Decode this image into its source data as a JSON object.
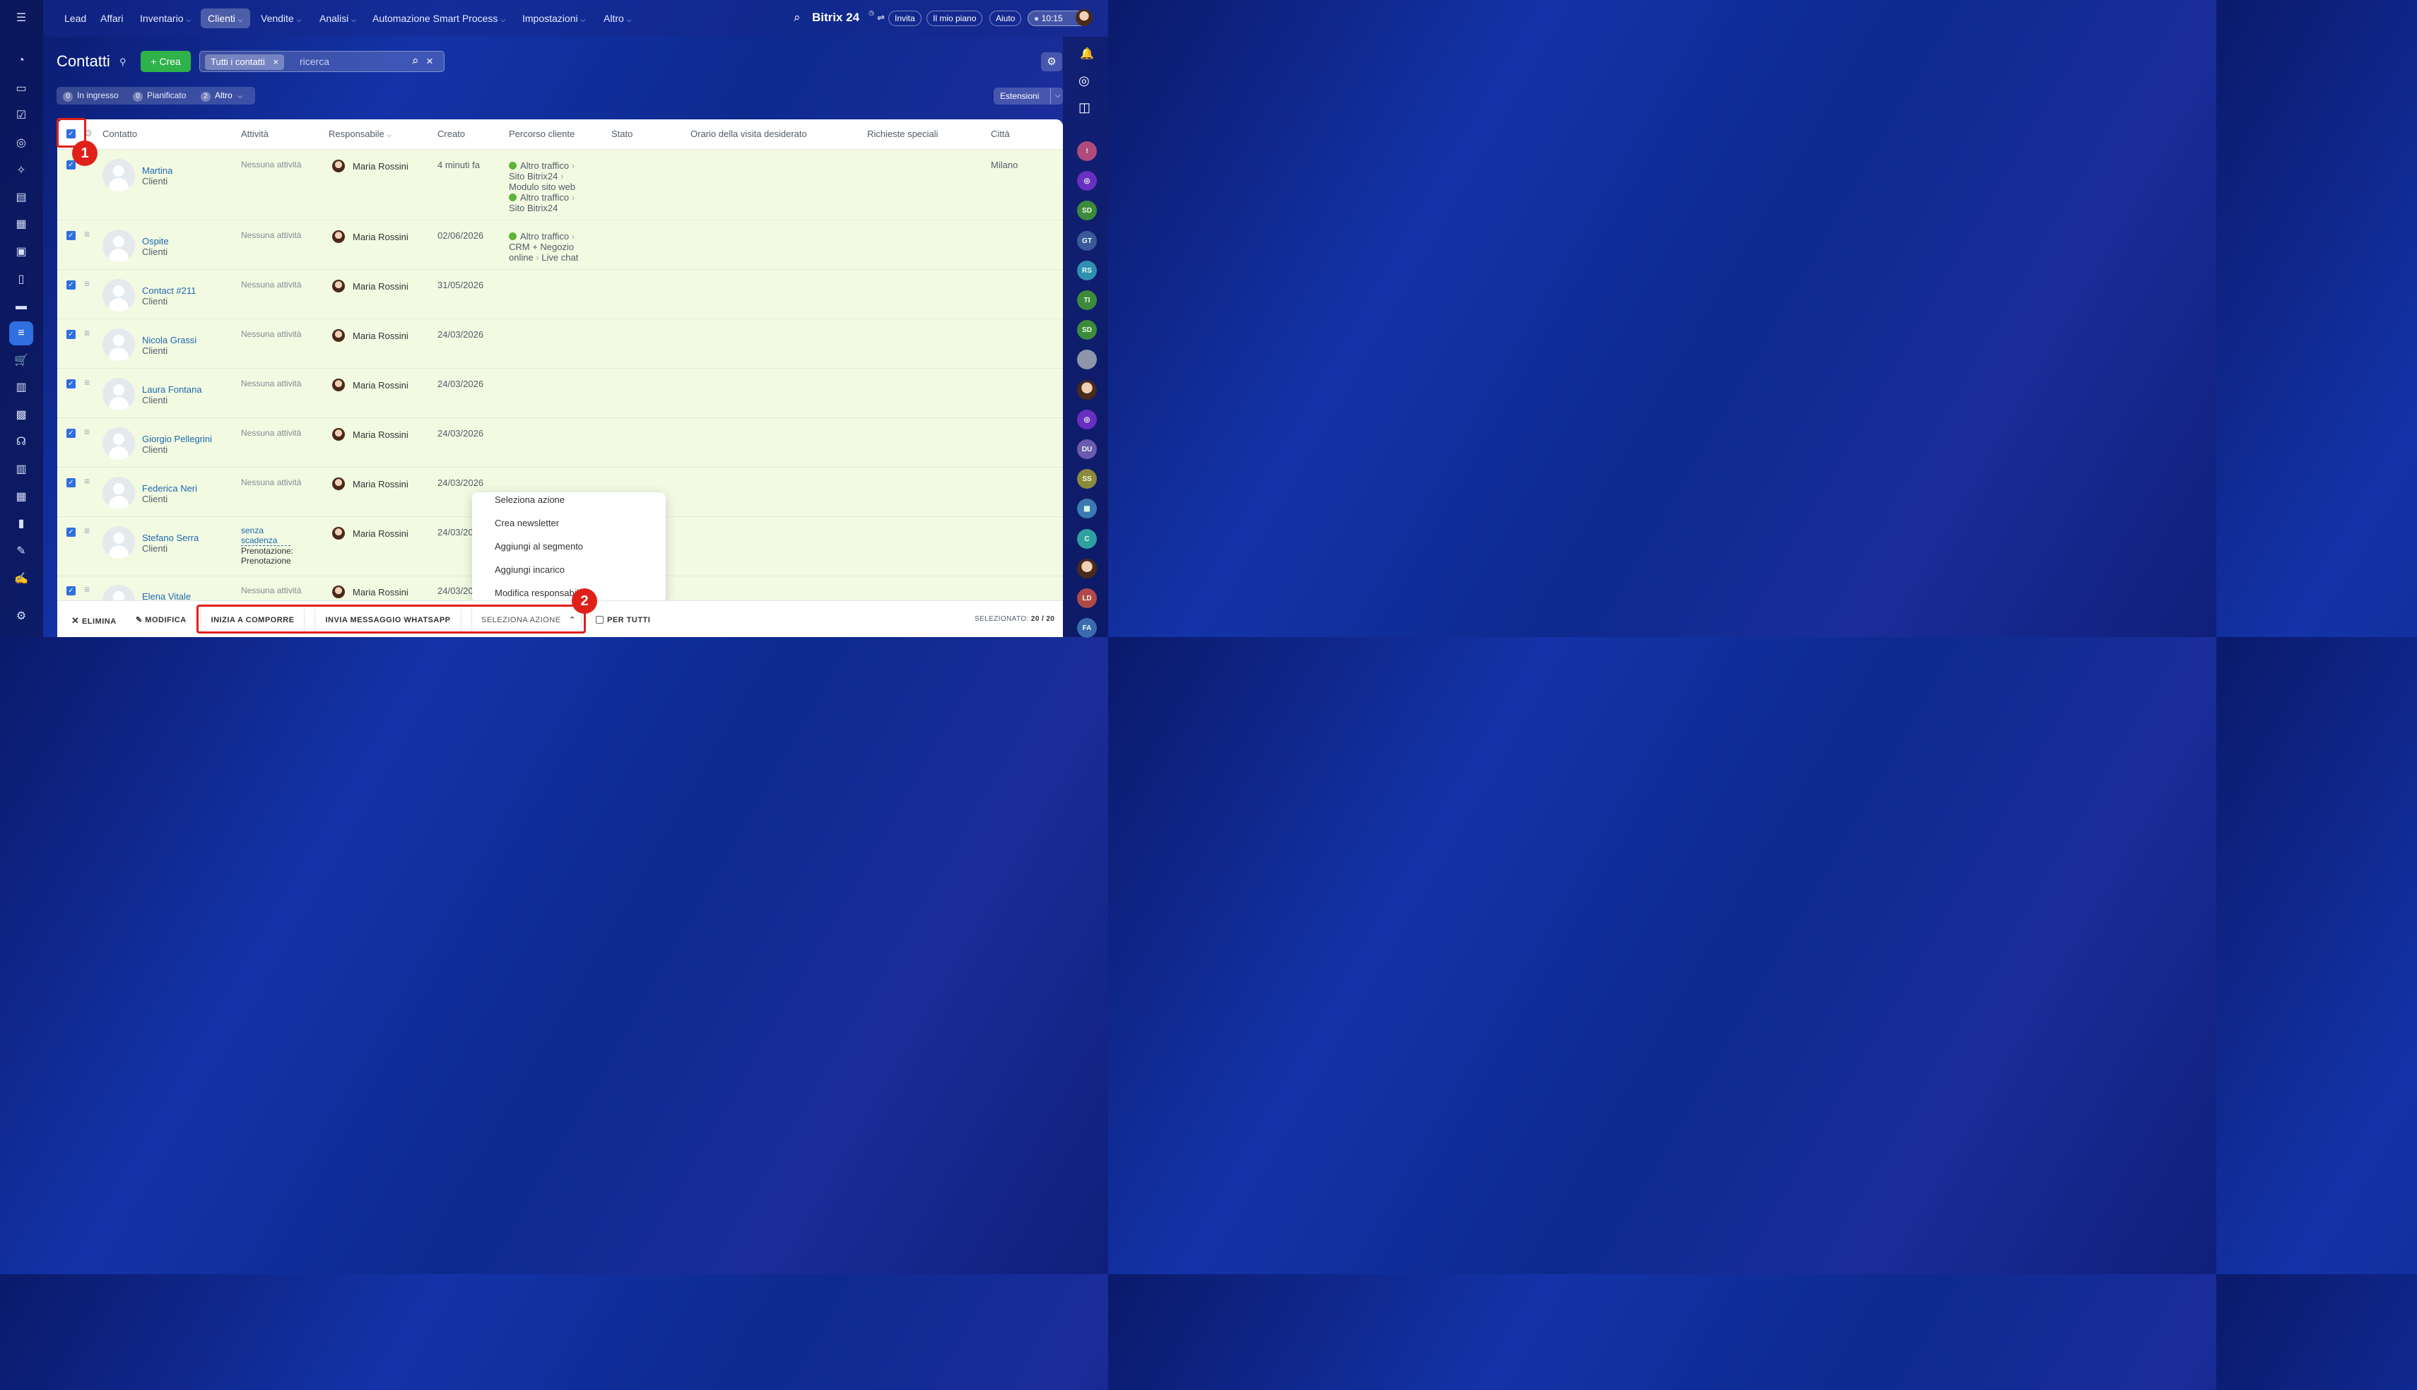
{
  "topnav": {
    "items": [
      "Lead",
      "Affari",
      "Inventario",
      "Clienti",
      "Vendite",
      "Analisi",
      "Automazione Smart Process",
      "Impostazioni",
      "Altro"
    ],
    "brand": "Bitrix 24",
    "invite": "Invita",
    "plan": "Il mio piano",
    "help": "Aiuto",
    "time": "10:15"
  },
  "page": {
    "title": "Contatti",
    "create_label": "Crea",
    "filter_chip": "Tutti i contatti",
    "search_placeholder": "ricerca",
    "counters": [
      {
        "count": "0",
        "label": "In ingresso"
      },
      {
        "count": "0",
        "label": "Pianificato"
      },
      {
        "count": "2",
        "label": "Altro"
      }
    ],
    "extensions": "Estensioni"
  },
  "table": {
    "headers": [
      "Contatto",
      "Attività",
      "Responsabile",
      "Creato",
      "Percorso cliente",
      "Stato",
      "Orario della visita desiderato",
      "Richieste speciali",
      "Città"
    ],
    "rows": [
      {
        "name": "Martina",
        "type": "Clienti",
        "activity": "Nessuna attività",
        "resp": "Maria Rossini",
        "created": "4 minuti fa",
        "path": [
          "Altro traffico",
          "Sito Bitrix24",
          "Modulo sito web",
          "Altro traffico",
          "Sito Bitrix24"
        ],
        "city": "Milano"
      },
      {
        "name": "Ospite",
        "type": "Clienti",
        "activity": "Nessuna attività",
        "resp": "Maria Rossini",
        "created": "02/06/2026",
        "path": [
          "Altro traffico",
          "CRM + Negozio",
          "online",
          "Live chat"
        ],
        "city": ""
      },
      {
        "name": "Contact #211",
        "type": "Clienti",
        "activity": "Nessuna attività",
        "resp": "Maria Rossini",
        "created": "31/05/2026",
        "path": [],
        "city": ""
      },
      {
        "name": "Nicola Grassi",
        "type": "Clienti",
        "activity": "Nessuna attività",
        "resp": "Maria Rossini",
        "created": "24/03/2026",
        "path": [],
        "city": ""
      },
      {
        "name": "Laura Fontana",
        "type": "Clienti",
        "activity": "Nessuna attività",
        "resp": "Maria Rossini",
        "created": "24/03/2026",
        "path": [],
        "city": ""
      },
      {
        "name": "Giorgio Pellegrini",
        "type": "Clienti",
        "activity": "Nessuna attività",
        "resp": "Maria Rossini",
        "created": "24/03/2026",
        "path": [],
        "city": ""
      },
      {
        "name": "Federica Neri",
        "type": "Clienti",
        "activity": "Nessuna attività",
        "resp": "Maria Rossini",
        "created": "24/03/2026",
        "path": [],
        "city": ""
      },
      {
        "name": "Stefano Serra",
        "type": "Clienti",
        "activity": "senza scadenza",
        "activity_extra": "Prenotazione: Prenotazione",
        "resp": "Maria Rossini",
        "created": "24/03/20",
        "path": [],
        "city": ""
      },
      {
        "name": "Elena Vitale",
        "type": "",
        "activity": "Nessuna attività",
        "resp": "Maria Rossini",
        "created": "24/03/20",
        "path": [],
        "city": ""
      }
    ]
  },
  "dropdown": {
    "items": [
      "Seleziona azione",
      "Crea newsletter",
      "Aggiungi al segmento",
      "Aggiungi incarico",
      "Modifica responsabile"
    ]
  },
  "bottombar": {
    "delete": "ELIMINA",
    "edit": "MODIFICA",
    "start_dial": "INIZIA A COMPORRE",
    "whatsapp": "INVIA MESSAGGIO WHATSAPP",
    "select_action": "SELEZIONA AZIONE",
    "for_all": "PER TUTTI",
    "selected_label": "SELEZIONATO:",
    "selected_value": "20 / 20"
  },
  "markers": [
    "1",
    "2"
  ],
  "right_rail_avatars": [
    "SD",
    "GT",
    "RS",
    "TI",
    "SD",
    "DU",
    "SS",
    "C",
    "LD",
    "FA"
  ],
  "colors": {
    "accent": "#2f6fe0",
    "create": "#2fb24a",
    "marker": "#e0201a",
    "row_bg": "#f2fae2"
  }
}
